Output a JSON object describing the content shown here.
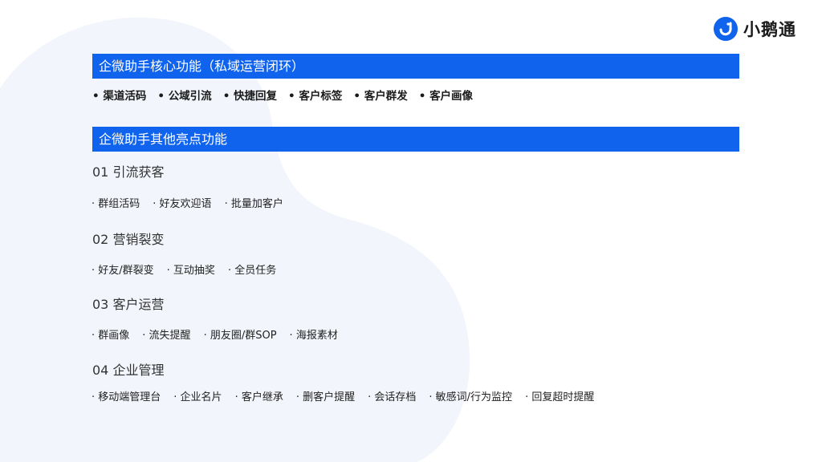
{
  "brand": {
    "name": "小鹅通",
    "color": "#0f63ec"
  },
  "core": {
    "title": "企微助手核心功能（私域运营闭环）",
    "items": [
      "渠道活码",
      "公域引流",
      "快捷回复",
      "客户标签",
      "客户群发",
      "客户画像"
    ]
  },
  "highlights": {
    "title": "企微助手其他亮点功能",
    "sections": [
      {
        "title": "01 引流获客",
        "items": [
          "群组活码",
          "好友欢迎语",
          "批量加客户"
        ]
      },
      {
        "title": "02 营销裂变",
        "items": [
          "好友/群裂变",
          "互动抽奖",
          "全员任务"
        ]
      },
      {
        "title": "03 客户运营",
        "items": [
          "群画像",
          "流失提醒",
          "朋友圈/群SOP",
          "海报素材"
        ]
      },
      {
        "title": "04 企业管理",
        "items": [
          "移动端管理台",
          "企业名片",
          "客户继承",
          "删客户提醒",
          "会话存档",
          "敏感词/行为监控",
          "回复超时提醒"
        ]
      }
    ]
  }
}
